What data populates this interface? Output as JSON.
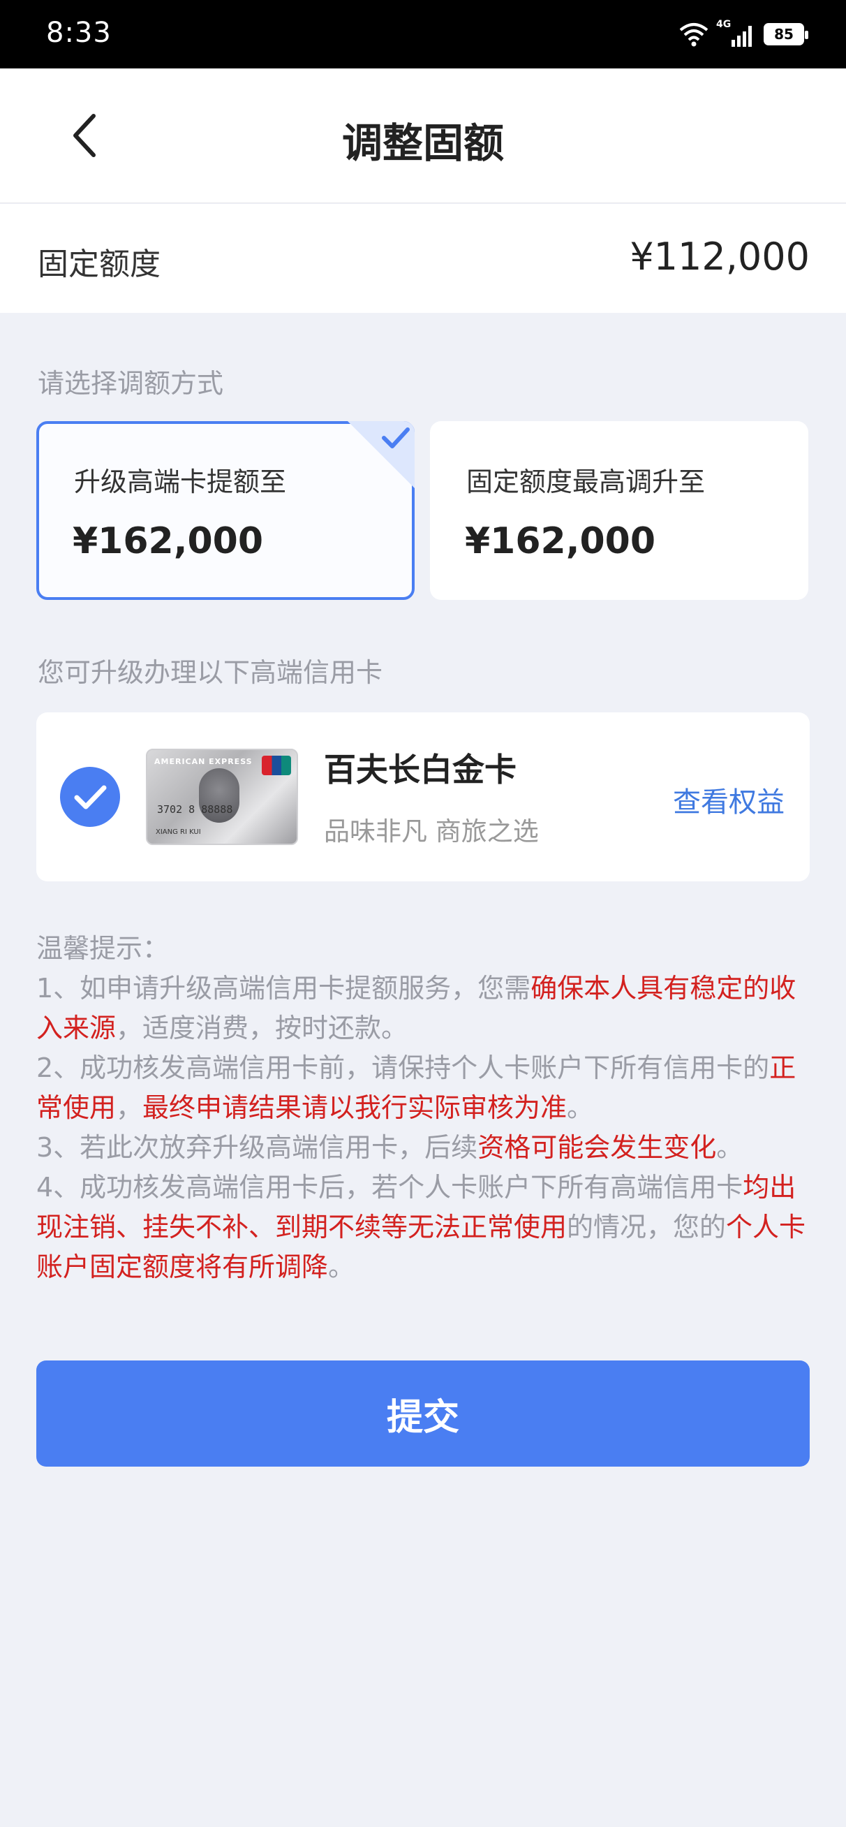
{
  "status_bar": {
    "time": "8:33",
    "network": "4G",
    "battery": "85"
  },
  "header": {
    "title": "调整固额"
  },
  "fixed_limit": {
    "label": "固定额度",
    "value": "¥112,000"
  },
  "method": {
    "hint": "请选择调额方式",
    "options": [
      {
        "label": "升级高端卡提额至",
        "value": "¥162,000",
        "selected": true
      },
      {
        "label": "固定额度最高调升至",
        "value": "¥162,000",
        "selected": false
      }
    ]
  },
  "upgrade": {
    "hint": "您可升级办理以下高端信用卡",
    "card": {
      "name": "百夫长白金卡",
      "slogan": "品味非凡 商旅之选",
      "link": "查看权益",
      "image_text": {
        "brand": "AMERICAN EXPRESS",
        "number": "3702 8   88888",
        "holder": "XIANG RI KUI"
      }
    }
  },
  "tips": {
    "title": "温馨提示：",
    "items": [
      [
        {
          "t": "1、如申请升级高端信用卡提额服务，您需",
          "red": false
        },
        {
          "t": "确保本人具有稳定的收入来源",
          "red": true
        },
        {
          "t": "，适度消费，按时还款。",
          "red": false
        }
      ],
      [
        {
          "t": "2、成功核发高端信用卡前，请保持个人卡账户下所有信用卡的",
          "red": false
        },
        {
          "t": "正常使用",
          "red": true
        },
        {
          "t": "，",
          "red": false
        },
        {
          "t": "最终申请结果请以我行实际审核为准",
          "red": true
        },
        {
          "t": "。",
          "red": false
        }
      ],
      [
        {
          "t": "3、若此次放弃升级高端信用卡，后续",
          "red": false
        },
        {
          "t": "资格可能会发生变化",
          "red": true
        },
        {
          "t": "。",
          "red": false
        }
      ],
      [
        {
          "t": "4、成功核发高端信用卡后，若个人卡账户下所有高端信用卡",
          "red": false
        },
        {
          "t": "均出现注销、挂失不补、到期不续等无法正常使用",
          "red": true
        },
        {
          "t": "的情况，您的",
          "red": false
        },
        {
          "t": "个人卡账户固定额度将有所调降",
          "red": true
        },
        {
          "t": "。",
          "red": false
        }
      ]
    ]
  },
  "submit_label": "提交",
  "colors": {
    "accent": "#4a7ef2",
    "warning_red": "#d3211f",
    "link_blue": "#3f79e0",
    "page_bg": "#eff1f7"
  }
}
